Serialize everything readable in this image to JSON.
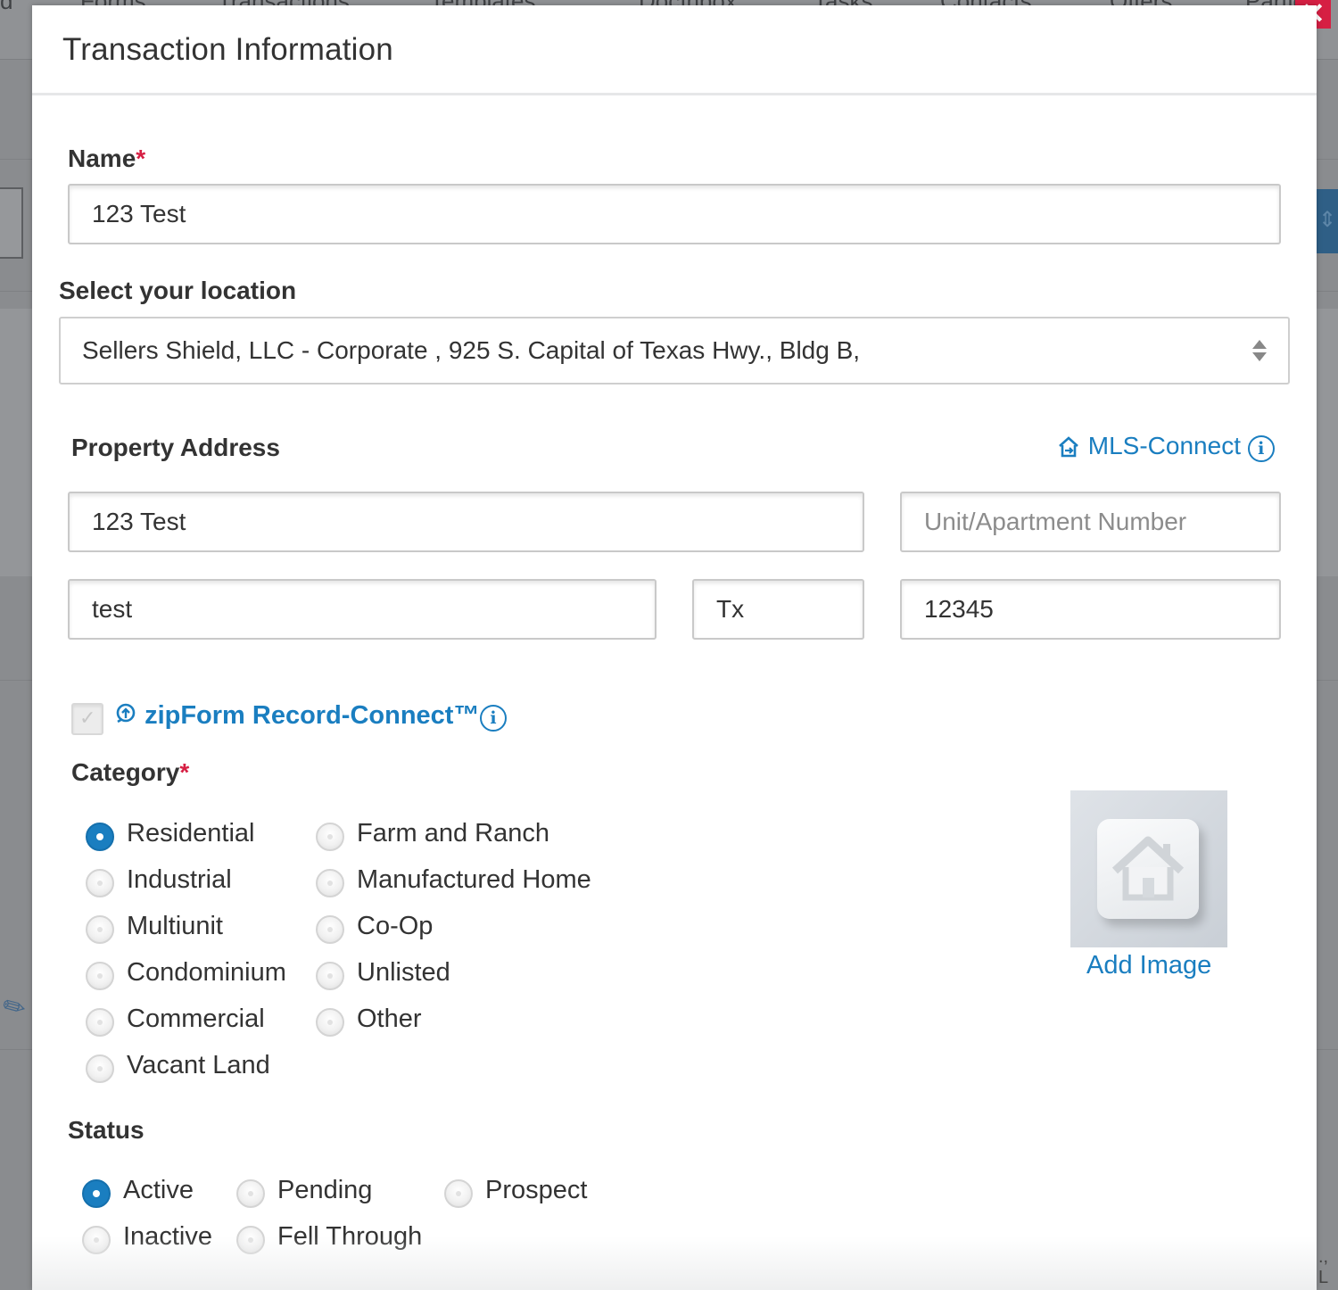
{
  "background": {
    "nav_items": [
      "d",
      "Forms",
      "Transactions",
      "Templates",
      "DocInbox",
      "Tasks",
      "Contacts",
      "Offers",
      "Parties"
    ],
    "footer_text": "., L"
  },
  "modal": {
    "title": "Transaction Information",
    "close_label": "✕",
    "name": {
      "label": "Name",
      "required_mark": "*",
      "value": "123 Test"
    },
    "location": {
      "label": "Select your location",
      "value": "Sellers Shield, LLC - Corporate , 925 S. Capital of Texas Hwy., Bldg B,"
    },
    "property_address": {
      "label": "Property Address",
      "mls_connect_label": "MLS-Connect",
      "street": "123 Test",
      "unit_placeholder": "Unit/Apartment Number",
      "unit_value": "",
      "city": "test",
      "state": "Tx",
      "zip": "12345"
    },
    "zipform": {
      "label": "zipForm Record-Connect™",
      "checked": true
    },
    "category": {
      "label": "Category",
      "required_mark": "*",
      "options_col1": [
        "Residential",
        "Industrial",
        "Multiunit",
        "Condominium",
        "Commercial",
        "Vacant Land"
      ],
      "options_col2": [
        "Farm and Ranch",
        "Manufactured Home",
        "Co-Op",
        "Unlisted",
        "Other"
      ],
      "selected": "Residential"
    },
    "image": {
      "add_label": "Add Image"
    },
    "status": {
      "label": "Status",
      "options": [
        "Active",
        "Pending",
        "Prospect",
        "Inactive",
        "Fell Through"
      ],
      "selected": "Active"
    },
    "accent_color": "#1a7ec0",
    "required_color": "#d61f43"
  }
}
